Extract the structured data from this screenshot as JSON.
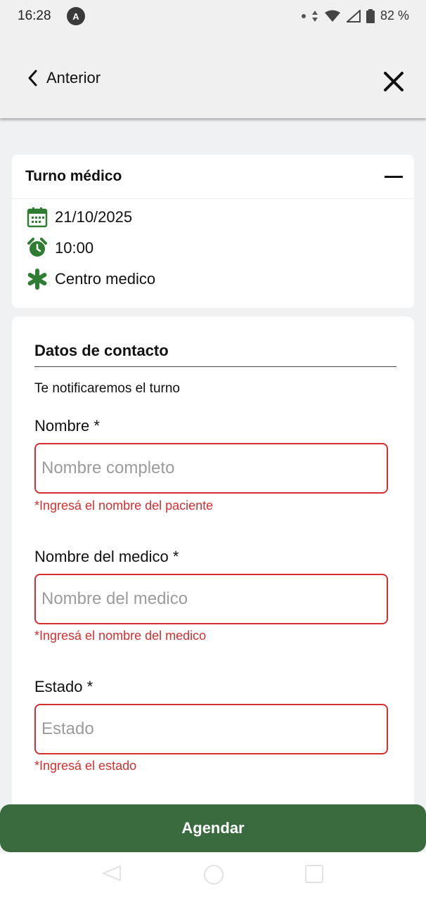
{
  "status_bar": {
    "time": "16:28",
    "app_icon": "A",
    "battery": "82 %"
  },
  "header": {
    "back_label": "Anterior"
  },
  "appointment": {
    "title": "Turno médico",
    "date": "21/10/2025",
    "time": "10:00",
    "location": "Centro medico"
  },
  "form": {
    "title": "Datos de contacto",
    "subtitle": "Te notificaremos el turno",
    "fields": [
      {
        "label": "Nombre *",
        "placeholder": "Nombre completo",
        "value": "",
        "error": "*Ingresá el nombre del paciente"
      },
      {
        "label": "Nombre del medico *",
        "placeholder": "Nombre del medico",
        "value": "",
        "error": "*Ingresá el nombre del medico"
      },
      {
        "label": "Estado *",
        "placeholder": "Estado",
        "value": "",
        "error": "*Ingresá el estado"
      }
    ]
  },
  "submit_label": "Agendar",
  "colors": {
    "accent_green": "#3a6b3e",
    "icon_green": "#2e7d32",
    "error_red": "#d32f2f"
  },
  "icons": [
    "calendar-icon",
    "alarm-clock-icon",
    "asterisk-icon",
    "chevron-left-icon",
    "close-icon"
  ]
}
